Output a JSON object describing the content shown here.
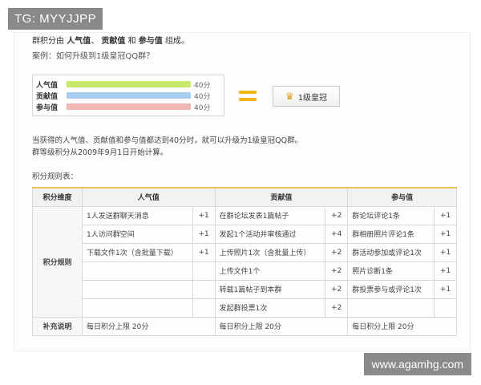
{
  "watermarks": {
    "top": "TG: MYYJJPP",
    "bottom": "www.agamhg.com"
  },
  "intro": {
    "prefix": "群积分由",
    "item1": "人气值",
    "sep1": "、",
    "item2": "贡献值",
    "conj": "和",
    "item3": "参与值",
    "suffix": "组成。",
    "example": "案例：如何升级到1级皇冠QQ群？"
  },
  "bars": [
    {
      "label": "人气值",
      "value_text": "40分",
      "fill_fraction": 1.0,
      "color": "#c8e86a"
    },
    {
      "label": "贡献值",
      "value_text": "40分",
      "fill_fraction": 1.0,
      "color": "#a9cdf0"
    },
    {
      "label": "参与值",
      "value_text": "40分",
      "fill_fraction": 1.0,
      "color": "#f0b7b3"
    }
  ],
  "crown_button": {
    "label": "1级皇冠",
    "icon": "crown-icon"
  },
  "notes": {
    "line1": "当获得的人气值、贡献值和参与值都达到40分时，就可以升级为1级皇冠QQ群。",
    "line2": "群等级积分从2009年9月1日开始计算。"
  },
  "table": {
    "title": "积分规则表：",
    "headers": [
      "积分维度",
      "人气值",
      "贡献值",
      "参与值"
    ],
    "row_label": "积分规则",
    "rows": [
      [
        "1人发送群聊天消息",
        "+1",
        "在群论坛发表1篇帖子",
        "+2",
        "群论坛评论1条",
        "+1"
      ],
      [
        "1人访问群空间",
        "+1",
        "发起1个活动并审核通过",
        "+4",
        "群相册照片评论1条",
        "+1"
      ],
      [
        "下载文件1次（含批量下载）",
        "+1",
        "上传照片1次（含批量上传）",
        "+2",
        "群活动参加或评论1次",
        "+1"
      ],
      [
        "",
        "",
        "上传文件1个",
        "+2",
        "照片诊断1条",
        "+1"
      ],
      [
        "",
        "",
        "转载1篇帖子到本群",
        "+2",
        "群投票参与或评论1次",
        "+1"
      ],
      [
        "",
        "",
        "发起群投票1次",
        "+2",
        "",
        ""
      ]
    ],
    "footer_label": "补充说明",
    "footer": [
      "每日积分上限  20分",
      "每日积分上限  20分",
      "每日积分上限  20分"
    ]
  }
}
